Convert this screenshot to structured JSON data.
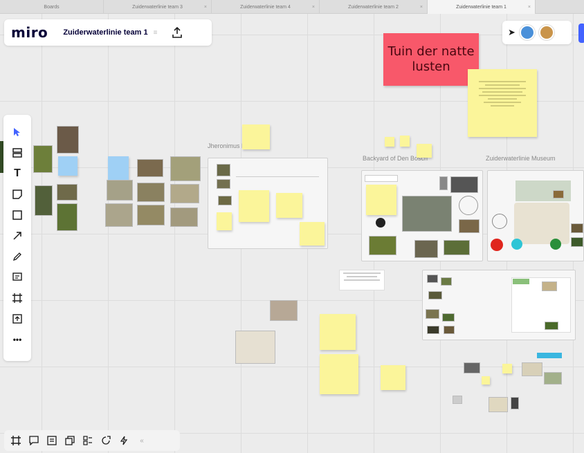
{
  "tabs": [
    {
      "label": "Boards",
      "active": false
    },
    {
      "label": "Zuiderwaterlinie team 3",
      "active": false
    },
    {
      "label": "Zuiderwaterlinie team 4",
      "active": false
    },
    {
      "label": "Zuiderwaterlinie team 2",
      "active": false
    },
    {
      "label": "Zuiderwaterlinie team 1",
      "active": true
    }
  ],
  "header": {
    "logo": "miro",
    "board_title": "Zuiderwaterlinie team 1",
    "upload_icon": "upload-icon"
  },
  "top_right": {
    "cursor_icon": "cursor-arrow-icon",
    "avatars": [
      "#4a90d9",
      "#c9944a"
    ]
  },
  "toolbar": {
    "tools": [
      {
        "name": "select-tool-icon",
        "glyph": "▲"
      },
      {
        "name": "templates-tool-icon",
        "glyph": "▤"
      },
      {
        "name": "text-tool-icon",
        "glyph": "T"
      },
      {
        "name": "sticky-note-tool-icon",
        "glyph": "◪"
      },
      {
        "name": "shape-tool-icon",
        "glyph": "□"
      },
      {
        "name": "connection-line-tool-icon",
        "glyph": "↗"
      },
      {
        "name": "pen-tool-icon",
        "glyph": "✎"
      },
      {
        "name": "comment-tool-icon",
        "glyph": "▣"
      },
      {
        "name": "frame-tool-icon",
        "glyph": "⌗"
      },
      {
        "name": "upload-tool-icon",
        "glyph": "⊞"
      },
      {
        "name": "more-tools-icon",
        "glyph": "•••"
      }
    ]
  },
  "bottom_toolbar": {
    "tools": [
      {
        "name": "frames-icon",
        "glyph": "⌗"
      },
      {
        "name": "comments-icon",
        "glyph": "◫"
      },
      {
        "name": "chat-icon",
        "glyph": "▤"
      },
      {
        "name": "cards-icon",
        "glyph": "⧉"
      },
      {
        "name": "kanban-icon",
        "glyph": "⊟"
      },
      {
        "name": "share-screen-icon",
        "glyph": "↗"
      },
      {
        "name": "activity-icon",
        "glyph": "ϟ"
      },
      {
        "name": "collapse-icon",
        "glyph": "«"
      }
    ]
  },
  "canvas": {
    "big_sticky": "Tuin der natte lusten",
    "frame_labels": [
      "Jheronimus Bosch",
      "Backyard of Den Bosch",
      "Zuiderwaterlinie Museum"
    ],
    "colors": {
      "pink_sticky": "#f8586a",
      "yellow_sticky": "#fbf59a",
      "blue_sticky": "#9fd0f5",
      "accent": "#4262ff"
    }
  }
}
